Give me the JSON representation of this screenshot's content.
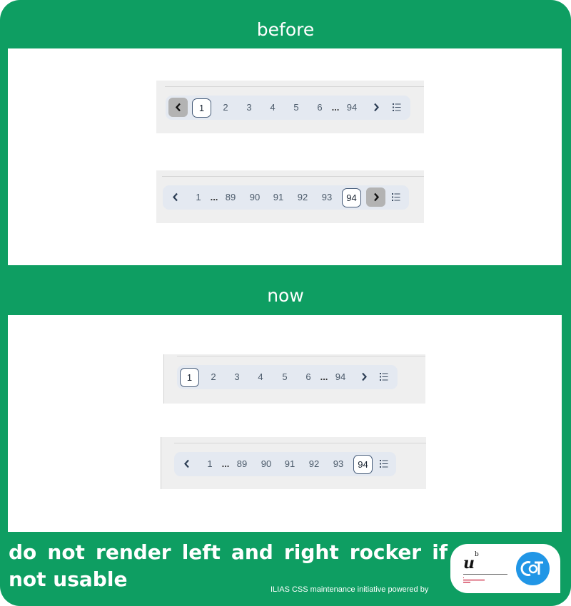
{
  "sections": {
    "before": "before",
    "now": "now"
  },
  "pager_before_first": {
    "pages": [
      "1",
      "2",
      "3",
      "4",
      "5",
      "6",
      "94"
    ],
    "ellipsis": "...",
    "active_page": "1",
    "hovered_arrow": "prev"
  },
  "pager_before_last": {
    "pages": [
      "1",
      "89",
      "90",
      "91",
      "92",
      "93",
      "94"
    ],
    "ellipsis": "...",
    "active_page": "94",
    "hovered_arrow": "next"
  },
  "pager_now_first": {
    "pages": [
      "1",
      "2",
      "3",
      "4",
      "5",
      "6",
      "94"
    ],
    "ellipsis": "...",
    "active_page": "1"
  },
  "pager_now_last": {
    "pages": [
      "1",
      "89",
      "90",
      "91",
      "92",
      "93",
      "94"
    ],
    "ellipsis": "...",
    "active_page": "94"
  },
  "footer": {
    "headline": "do not render left and right rocker if not usable",
    "credit": "ILIAS CSS maintenance initiative powered by"
  },
  "logos": {
    "university": "u b UNIVERSITÄT BERN",
    "cat": "CaT"
  },
  "colors": {
    "background": "#0e9e62",
    "pager_bg": "#e4e9f1",
    "active_border": "#445a78",
    "hover_arrow_bg": "#b3b3b3"
  },
  "icons": [
    "chevron-left-icon",
    "chevron-right-icon",
    "list-icon"
  ]
}
